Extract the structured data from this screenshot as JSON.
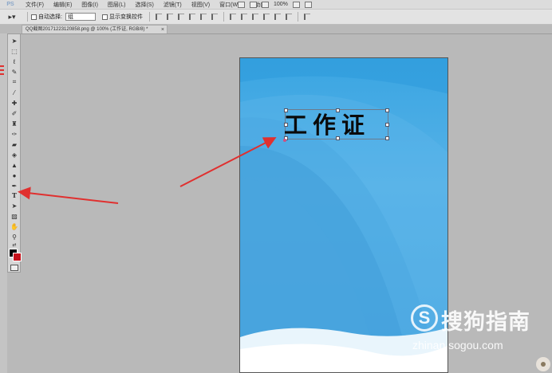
{
  "app": {
    "logo_text": "PS"
  },
  "menu": [
    "文件(F)",
    "编辑(E)",
    "图像(I)",
    "图层(L)",
    "选择(S)",
    "滤镜(T)",
    "视图(V)",
    "窗口(W)",
    "帮助(H)"
  ],
  "toolbar_zoom": "100%",
  "options_bar": {
    "auto_select_label": "自动选择:",
    "auto_select_value": "组",
    "show_transform_label": "显示变换控件"
  },
  "document_tab": {
    "title": "QQ截图20171223120858.png @ 100% (工作证, RGB/8) *",
    "close": "×"
  },
  "canvas": {
    "text_layer": "工作证"
  },
  "tools": [
    "move",
    "marquee",
    "lasso",
    "quick-select",
    "crop",
    "eyedropper",
    "healing",
    "brush",
    "stamp",
    "history-brush",
    "eraser",
    "gradient",
    "blur",
    "dodge",
    "pen",
    "type",
    "path-select",
    "shape",
    "hand",
    "zoom"
  ],
  "watermark": {
    "logo": "S",
    "brand": "搜狗指南",
    "url": "zhinan.sogou.com"
  },
  "colors": {
    "foreground": "#000000",
    "background": "#c4101a",
    "arrow": "#e0302f"
  }
}
